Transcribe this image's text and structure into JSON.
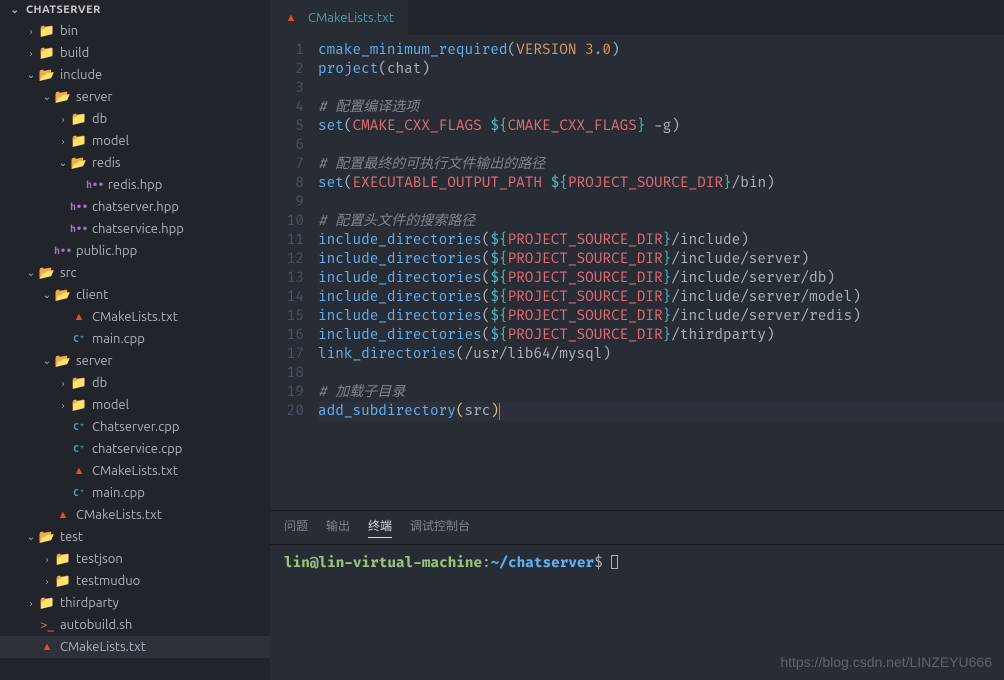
{
  "sidebar": {
    "title": "CHATSERVER",
    "items": [
      {
        "label": "bin",
        "icon": "folder",
        "color": "folder",
        "depth": 1,
        "chev": ">"
      },
      {
        "label": "build",
        "icon": "folder",
        "color": "folder",
        "depth": 1,
        "chev": ">"
      },
      {
        "label": "include",
        "icon": "folder",
        "color": "folder green",
        "depth": 1,
        "chev": "v"
      },
      {
        "label": "server",
        "icon": "folder",
        "color": "folder blue",
        "depth": 2,
        "chev": "v"
      },
      {
        "label": "db",
        "icon": "folder",
        "color": "folder",
        "depth": 3,
        "chev": ">"
      },
      {
        "label": "model",
        "icon": "folder",
        "color": "folder",
        "depth": 3,
        "chev": ">"
      },
      {
        "label": "redis",
        "icon": "folder",
        "color": "folder grey",
        "depth": 3,
        "chev": "v"
      },
      {
        "label": "redis.hpp",
        "icon": "h••",
        "color": "file-hpp",
        "depth": 4,
        "chev": ""
      },
      {
        "label": "chatserver.hpp",
        "icon": "h••",
        "color": "file-hpp",
        "depth": 3,
        "chev": ""
      },
      {
        "label": "chatservice.hpp",
        "icon": "h••",
        "color": "file-hpp",
        "depth": 3,
        "chev": ""
      },
      {
        "label": "public.hpp",
        "icon": "h••",
        "color": "file-hpp",
        "depth": 2,
        "chev": ""
      },
      {
        "label": "src",
        "icon": "folder",
        "color": "folder green",
        "depth": 1,
        "chev": "v"
      },
      {
        "label": "client",
        "icon": "folder",
        "color": "folder blue",
        "depth": 2,
        "chev": "v"
      },
      {
        "label": "CMakeLists.txt",
        "icon": "▲",
        "color": "file-cmake",
        "depth": 3,
        "chev": ""
      },
      {
        "label": "main.cpp",
        "icon": "C⁺",
        "color": "file-cpp",
        "depth": 3,
        "chev": ""
      },
      {
        "label": "server",
        "icon": "folder",
        "color": "folder",
        "depth": 2,
        "chev": "v"
      },
      {
        "label": "db",
        "icon": "folder",
        "color": "folder",
        "depth": 3,
        "chev": ">"
      },
      {
        "label": "model",
        "icon": "folder",
        "color": "folder",
        "depth": 3,
        "chev": ">"
      },
      {
        "label": "Chatserver.cpp",
        "icon": "C⁺",
        "color": "file-cpp",
        "depth": 3,
        "chev": ""
      },
      {
        "label": "chatservice.cpp",
        "icon": "C⁺",
        "color": "file-cpp",
        "depth": 3,
        "chev": ""
      },
      {
        "label": "CMakeLists.txt",
        "icon": "▲",
        "color": "file-cmake",
        "depth": 3,
        "chev": ""
      },
      {
        "label": "main.cpp",
        "icon": "C⁺",
        "color": "file-cpp",
        "depth": 3,
        "chev": ""
      },
      {
        "label": "CMakeLists.txt",
        "icon": "▲",
        "color": "file-cmake",
        "depth": 2,
        "chev": ""
      },
      {
        "label": "test",
        "icon": "folder",
        "color": "folder green",
        "depth": 1,
        "chev": "v"
      },
      {
        "label": "testjson",
        "icon": "folder",
        "color": "folder grey",
        "depth": 2,
        "chev": ">"
      },
      {
        "label": "testmuduo",
        "icon": "folder",
        "color": "folder grey",
        "depth": 2,
        "chev": ">"
      },
      {
        "label": "thirdparty",
        "icon": "folder",
        "color": "folder grey",
        "depth": 1,
        "chev": ">"
      },
      {
        "label": "autobuild.sh",
        "icon": ">_",
        "color": "file-sh",
        "depth": 1,
        "chev": ""
      },
      {
        "label": "CMakeLists.txt",
        "icon": "▲",
        "color": "file-cmake",
        "depth": 1,
        "chev": "",
        "selected": true
      }
    ]
  },
  "editor": {
    "tab_label": "CMakeLists.txt",
    "lines": [
      [
        {
          "t": "cmake_minimum_required",
          "c": "fn"
        },
        {
          "t": "(",
          "c": "paren"
        },
        {
          "t": "VERSION 3.0",
          "c": "const"
        },
        {
          "t": ")",
          "c": "paren"
        }
      ],
      [
        {
          "t": "project",
          "c": "fn"
        },
        {
          "t": "(",
          "c": "paren"
        },
        {
          "t": "chat",
          "c": "flag"
        },
        {
          "t": ")",
          "c": "paren"
        }
      ],
      [],
      [
        {
          "t": "# 配置编译选项",
          "c": "cmt"
        }
      ],
      [
        {
          "t": "set",
          "c": "fn"
        },
        {
          "t": "(",
          "c": "paren"
        },
        {
          "t": "CMAKE_CXX_FLAGS",
          "c": "var-self"
        },
        {
          "t": " ",
          "c": "flag"
        },
        {
          "t": "${",
          "c": "op"
        },
        {
          "t": "CMAKE_CXX_FLAGS",
          "c": "var-self"
        },
        {
          "t": "}",
          "c": "op"
        },
        {
          "t": " -g",
          "c": "flag"
        },
        {
          "t": ")",
          "c": "paren"
        }
      ],
      [],
      [
        {
          "t": "# 配置最终的可执行文件输出的路径",
          "c": "cmt"
        }
      ],
      [
        {
          "t": "set",
          "c": "fn"
        },
        {
          "t": "(",
          "c": "paren"
        },
        {
          "t": "EXECUTABLE_OUTPUT_PATH",
          "c": "var-self"
        },
        {
          "t": " ",
          "c": "flag"
        },
        {
          "t": "${",
          "c": "op"
        },
        {
          "t": "PROJECT_SOURCE_DIR",
          "c": "var-self"
        },
        {
          "t": "}",
          "c": "op"
        },
        {
          "t": "/bin",
          "c": "flag"
        },
        {
          "t": ")",
          "c": "paren"
        }
      ],
      [],
      [
        {
          "t": "# 配置头文件的搜索路径",
          "c": "cmt"
        }
      ],
      [
        {
          "t": "include_directories",
          "c": "fn"
        },
        {
          "t": "(",
          "c": "paren"
        },
        {
          "t": "${",
          "c": "op"
        },
        {
          "t": "PROJECT_SOURCE_DIR",
          "c": "var-self"
        },
        {
          "t": "}",
          "c": "op"
        },
        {
          "t": "/include",
          "c": "flag"
        },
        {
          "t": ")",
          "c": "paren"
        }
      ],
      [
        {
          "t": "include_directories",
          "c": "fn"
        },
        {
          "t": "(",
          "c": "paren"
        },
        {
          "t": "${",
          "c": "op"
        },
        {
          "t": "PROJECT_SOURCE_DIR",
          "c": "var-self"
        },
        {
          "t": "}",
          "c": "op"
        },
        {
          "t": "/include/server",
          "c": "flag"
        },
        {
          "t": ")",
          "c": "paren"
        }
      ],
      [
        {
          "t": "include_directories",
          "c": "fn"
        },
        {
          "t": "(",
          "c": "paren"
        },
        {
          "t": "${",
          "c": "op"
        },
        {
          "t": "PROJECT_SOURCE_DIR",
          "c": "var-self"
        },
        {
          "t": "}",
          "c": "op"
        },
        {
          "t": "/include/server/db",
          "c": "flag"
        },
        {
          "t": ")",
          "c": "paren"
        }
      ],
      [
        {
          "t": "include_directories",
          "c": "fn"
        },
        {
          "t": "(",
          "c": "paren"
        },
        {
          "t": "${",
          "c": "op"
        },
        {
          "t": "PROJECT_SOURCE_DIR",
          "c": "var-self"
        },
        {
          "t": "}",
          "c": "op"
        },
        {
          "t": "/include/server/model",
          "c": "flag"
        },
        {
          "t": ")",
          "c": "paren"
        }
      ],
      [
        {
          "t": "include_directories",
          "c": "fn"
        },
        {
          "t": "(",
          "c": "paren"
        },
        {
          "t": "${",
          "c": "op"
        },
        {
          "t": "PROJECT_SOURCE_DIR",
          "c": "var-self"
        },
        {
          "t": "}",
          "c": "op"
        },
        {
          "t": "/include/server/redis",
          "c": "flag"
        },
        {
          "t": ")",
          "c": "paren"
        }
      ],
      [
        {
          "t": "include_directories",
          "c": "fn"
        },
        {
          "t": "(",
          "c": "paren"
        },
        {
          "t": "${",
          "c": "op"
        },
        {
          "t": "PROJECT_SOURCE_DIR",
          "c": "var-self"
        },
        {
          "t": "}",
          "c": "op"
        },
        {
          "t": "/thirdparty",
          "c": "flag"
        },
        {
          "t": ")",
          "c": "paren"
        }
      ],
      [
        {
          "t": "link_directories",
          "c": "fn"
        },
        {
          "t": "(",
          "c": "paren"
        },
        {
          "t": "/usr/lib64/mysql",
          "c": "flag"
        },
        {
          "t": ")",
          "c": "paren"
        }
      ],
      [],
      [
        {
          "t": "# 加载子目录",
          "c": "cmt"
        }
      ],
      [
        {
          "t": "add_subdirectory",
          "c": "fn"
        },
        {
          "t": "(",
          "c": "interp"
        },
        {
          "t": "src",
          "c": "flag"
        },
        {
          "t": ")",
          "c": "interp"
        }
      ]
    ]
  },
  "terminal": {
    "tabs": [
      "问题",
      "输出",
      "终端",
      "调试控制台"
    ],
    "active_tab": 2,
    "prompt_user": "lin@lin-virtual-machine",
    "prompt_colon": ":",
    "prompt_path": "~/chatserver",
    "prompt_tail": "$ "
  },
  "watermark": "https://blog.csdn.net/LINZEYU666"
}
